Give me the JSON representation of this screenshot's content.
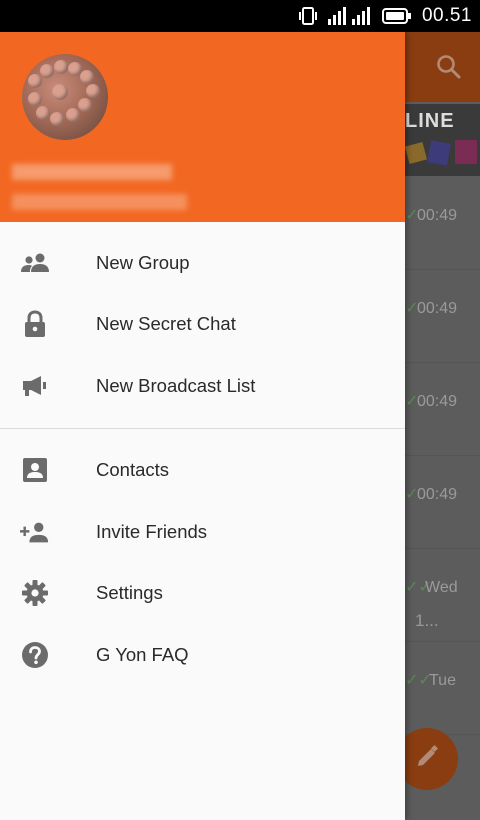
{
  "status_bar": {
    "time": "00.51",
    "icons": [
      "vibrate-icon",
      "signal-icon",
      "signal-icon",
      "battery-icon"
    ]
  },
  "background_app": {
    "banner_text": "LINE",
    "chat_rows": [
      {
        "time": "00:49",
        "preview": ""
      },
      {
        "time": "00:49",
        "preview": ""
      },
      {
        "time": "00:49",
        "preview": ""
      },
      {
        "time": "00:49",
        "preview": ""
      },
      {
        "time": "Wed",
        "preview": "1..."
      },
      {
        "time": "Tue",
        "preview": ""
      }
    ]
  },
  "drawer": {
    "menu_group_1": [
      {
        "label": "New Group",
        "icon": "group-icon"
      },
      {
        "label": "New Secret Chat",
        "icon": "lock-icon"
      },
      {
        "label": "New Broadcast List",
        "icon": "megaphone-icon"
      }
    ],
    "menu_group_2": [
      {
        "label": "Contacts",
        "icon": "contact-card-icon"
      },
      {
        "label": "Invite Friends",
        "icon": "add-person-icon"
      },
      {
        "label": "Settings",
        "icon": "gear-icon"
      },
      {
        "label": "G Yon FAQ",
        "icon": "help-icon"
      }
    ]
  },
  "colors": {
    "accent": "#f26722",
    "accent_dimmed": "#8a3d10",
    "icon_gray": "#6b6b6b"
  }
}
